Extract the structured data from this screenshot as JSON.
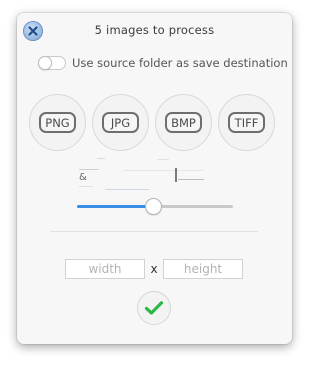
{
  "window": {
    "title": "5 images to process"
  },
  "icons": {
    "close": "close-icon",
    "confirm": "checkmark-icon"
  },
  "options": {
    "use_source_folder_label": "Use source folder as save destination",
    "use_source_folder_on": false
  },
  "formats": [
    {
      "label": "PNG"
    },
    {
      "label": "JPG"
    },
    {
      "label": "BMP"
    },
    {
      "label": "TIFF"
    }
  ],
  "glitch": {
    "symbol": "&"
  },
  "quality_slider": {
    "level": 0.49
  },
  "dimensions": {
    "width_placeholder": "width",
    "separator": "x",
    "height_placeholder": "height"
  },
  "colors": {
    "accent": "#3b8ee6",
    "confirm": "#2fb84a",
    "close": "#7da5d3"
  }
}
